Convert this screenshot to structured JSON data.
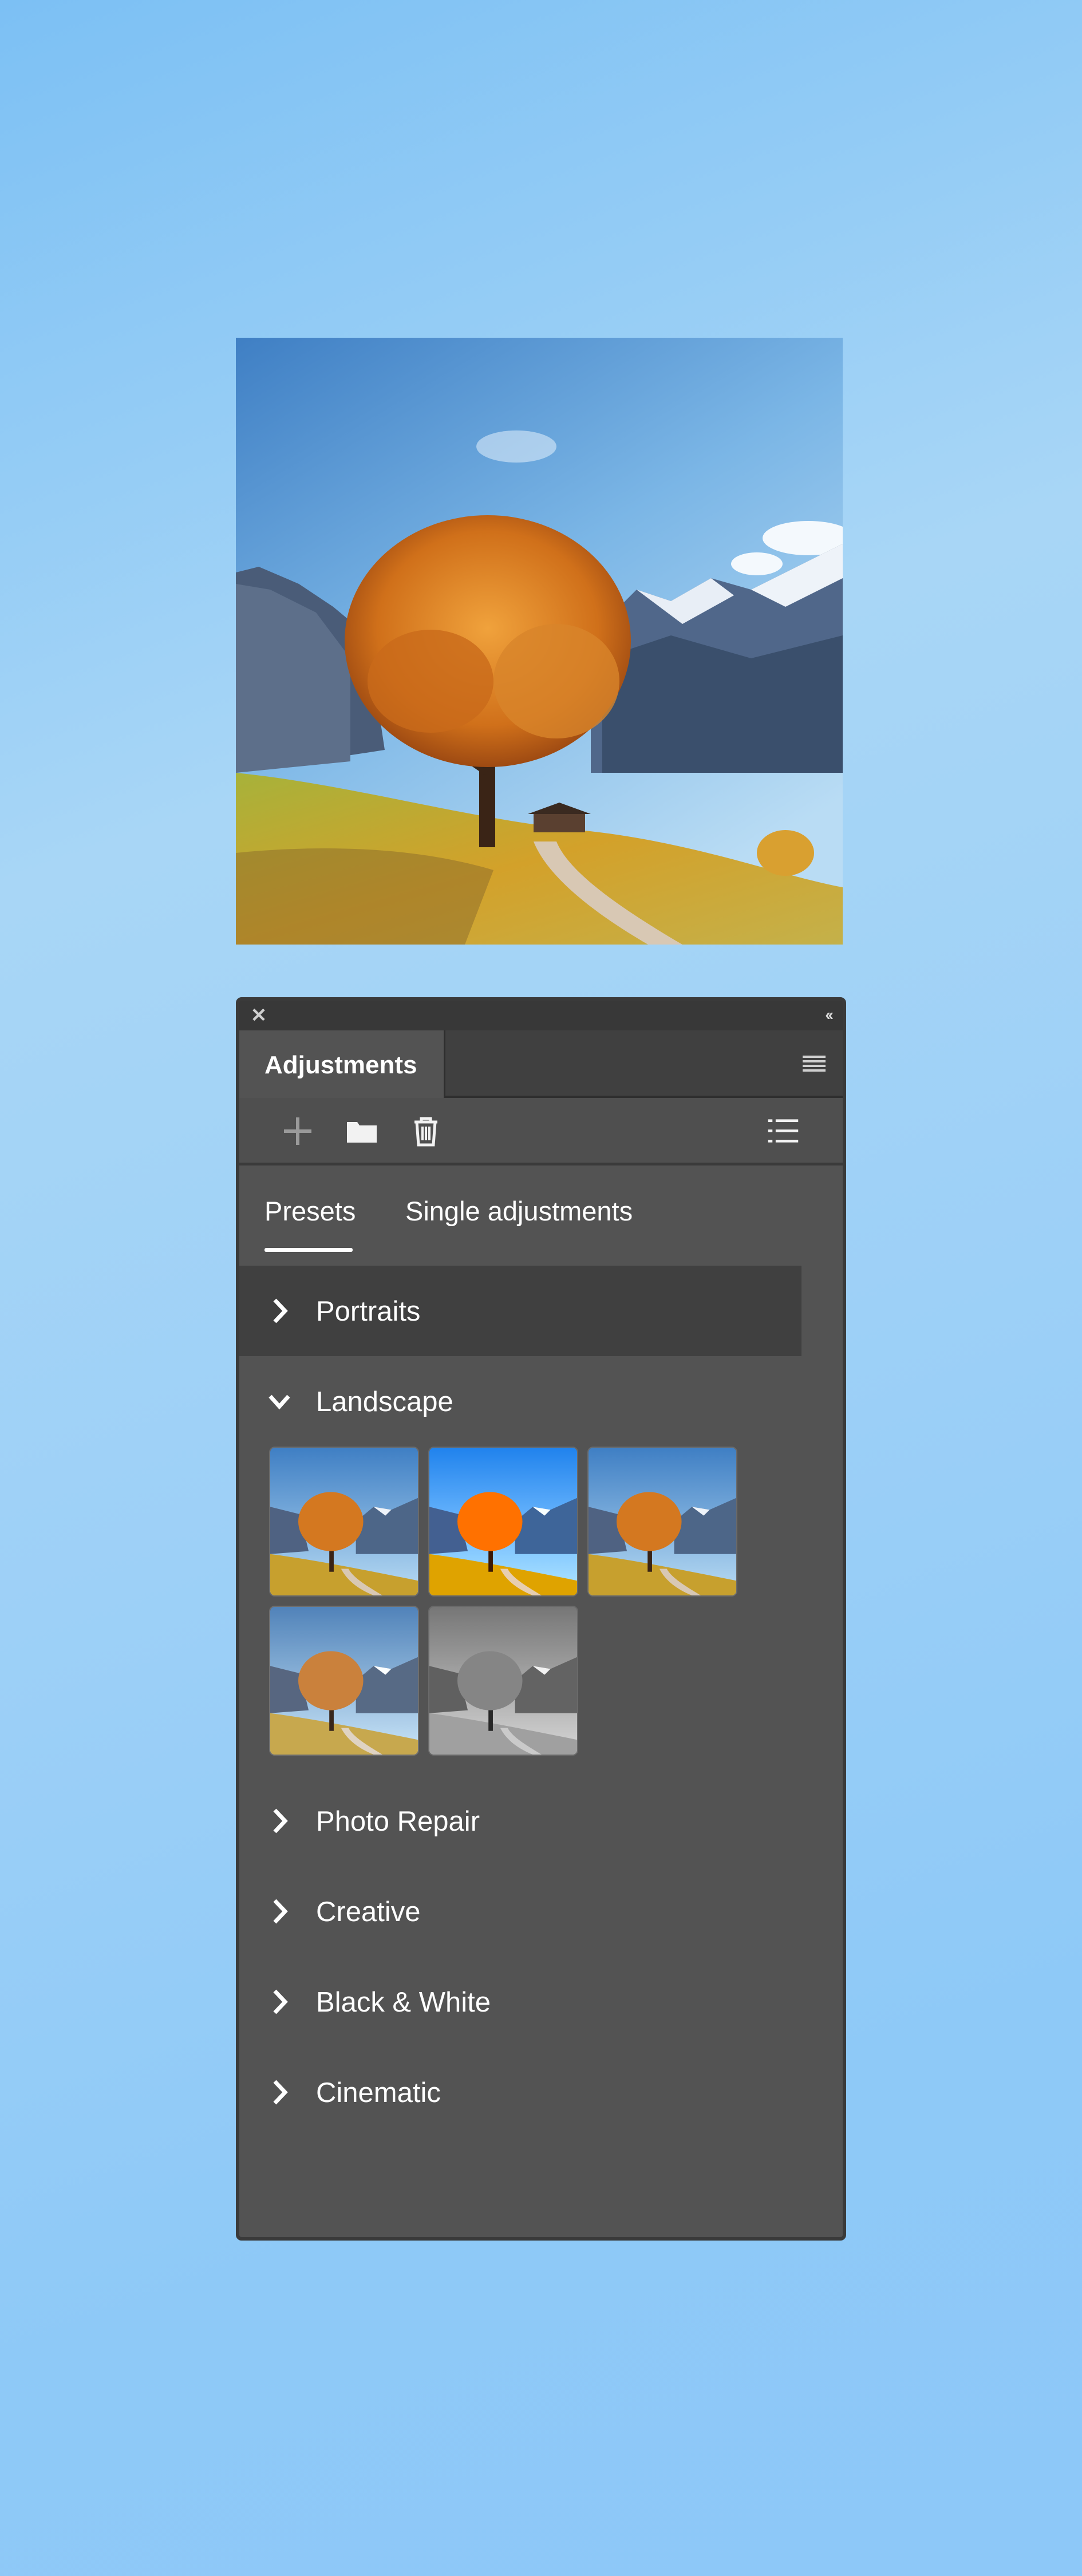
{
  "hero": {
    "label": "Landscape photo"
  },
  "panel": {
    "close_glyph": "✕",
    "collapse_glyph": "‹‹",
    "tab_title": "Adjustments",
    "toolbar": {
      "add_icon": "plus-icon",
      "folder_icon": "folder-icon",
      "delete_icon": "trash-icon",
      "list_icon": "list-view-icon"
    },
    "subtabs": [
      "Presets",
      "Single adjustments"
    ],
    "sections": [
      {
        "label": "Portraits",
        "expanded": false
      },
      {
        "label": "Landscape",
        "expanded": true
      },
      {
        "label": "Photo Repair",
        "expanded": false
      },
      {
        "label": "Creative",
        "expanded": false
      },
      {
        "label": "Black & White",
        "expanded": false
      },
      {
        "label": "Cinematic",
        "expanded": false
      }
    ],
    "landscape_presets": [
      {
        "style": "color"
      },
      {
        "style": "vivid"
      },
      {
        "style": "color"
      },
      {
        "style": "faded"
      },
      {
        "style": "grayscale"
      }
    ]
  }
}
